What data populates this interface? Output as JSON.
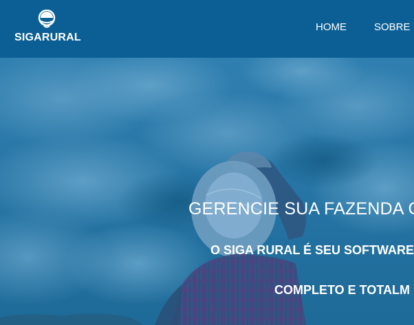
{
  "brand": {
    "name": "SIGARURAL",
    "logo_icon": "sunrise-signal-icon"
  },
  "nav": {
    "items": [
      {
        "label": "HOME"
      },
      {
        "label": "SOBRE"
      }
    ]
  },
  "hero": {
    "title": "GERENCIE SUA FAZENDA C",
    "subtitle_line1": "O SIGA RURAL É SEU SOFTWARE",
    "subtitle_line2": "COMPLETO E TOTALM"
  },
  "colors": {
    "navbar": "#0b5f94",
    "hero_overlay": "#1a6b9a",
    "text": "#ffffff"
  }
}
